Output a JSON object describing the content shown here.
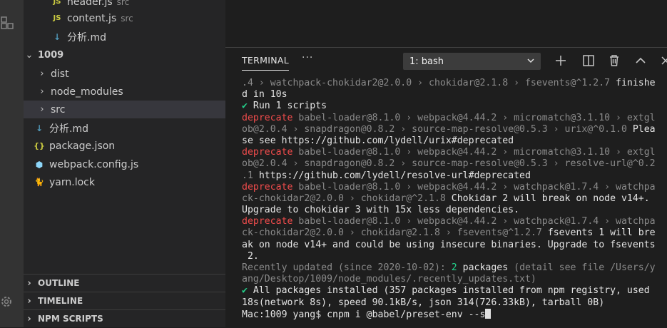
{
  "explorer": {
    "items": [
      {
        "name": "header.js",
        "desc": "src",
        "icon": "JS"
      },
      {
        "name": "content.js",
        "desc": "src",
        "icon": "JS"
      },
      {
        "name": "分析.md",
        "desc": "",
        "icon": "↓"
      }
    ],
    "folder": "1009",
    "children": [
      {
        "name": "dist"
      },
      {
        "name": "node_modules"
      },
      {
        "name": "src"
      },
      {
        "name": "分析.md",
        "icon": "↓"
      },
      {
        "name": "package.json",
        "icon": "{}"
      },
      {
        "name": "webpack.config.js",
        "icon": "⬢"
      },
      {
        "name": "yarn.lock",
        "icon": "🐈"
      }
    ]
  },
  "sections": {
    "outline": "OUTLINE",
    "timeline": "TIMELINE",
    "npm_scripts": "NPM SCRIPTS"
  },
  "panel": {
    "tab": "TERMINAL",
    "more": "···",
    "selected_terminal": "1: bash"
  },
  "terminal_lines": [
    [
      {
        "c": "dim",
        "t": ".4 › watchpack-chokidar2@2.0.0 › chokidar@2.1.8 › fsevents@^1.2.7 "
      },
      {
        "c": "wht",
        "t": "finishe"
      }
    ],
    [
      {
        "c": "wht",
        "t": "d in 10s"
      }
    ],
    [
      {
        "c": "grn",
        "t": "✔ "
      },
      {
        "c": "wht",
        "t": "Run 1 scripts"
      }
    ],
    [
      {
        "c": "red",
        "t": "deprecate "
      },
      {
        "c": "dim",
        "t": "babel-loader@8.1.0 › webpack@4.44.2 › micromatch@3.1.10 › extgl"
      }
    ],
    [
      {
        "c": "dim",
        "t": "ob@2.0.4 › snapdragon@0.8.2 › source-map-resolve@0.5.3 › urix@^0.1.0 "
      },
      {
        "c": "wht",
        "t": "Plea"
      }
    ],
    [
      {
        "c": "wht",
        "t": "se see https://github.com/lydell/urix#deprecated"
      }
    ],
    [
      {
        "c": "red",
        "t": "deprecate "
      },
      {
        "c": "dim",
        "t": "babel-loader@8.1.0 › webpack@4.44.2 › micromatch@3.1.10 › extgl"
      }
    ],
    [
      {
        "c": "dim",
        "t": "ob@2.0.4 › snapdragon@0.8.2 › source-map-resolve@0.5.3 › resolve-url@^0.2"
      }
    ],
    [
      {
        "c": "dim",
        "t": ".1 "
      },
      {
        "c": "wht",
        "t": "https://github.com/lydell/resolve-url#deprecated"
      }
    ],
    [
      {
        "c": "red",
        "t": "deprecate "
      },
      {
        "c": "dim",
        "t": "babel-loader@8.1.0 › webpack@4.44.2 › watchpack@1.7.4 › watchpa"
      }
    ],
    [
      {
        "c": "dim",
        "t": "ck-chokidar2@2.0.0 › chokidar@^2.1.8 "
      },
      {
        "c": "wht",
        "t": "Chokidar 2 will break on node v14+."
      }
    ],
    [
      {
        "c": "wht",
        "t": "Upgrade to chokidar 3 with 15x less dependencies."
      }
    ],
    [
      {
        "c": "red",
        "t": "deprecate "
      },
      {
        "c": "dim",
        "t": "babel-loader@8.1.0 › webpack@4.44.2 › watchpack@1.7.4 › watchpa"
      }
    ],
    [
      {
        "c": "dim",
        "t": "ck-chokidar2@2.0.0 › chokidar@2.1.8 › fsevents@^1.2.7 "
      },
      {
        "c": "wht",
        "t": "fsevents 1 will bre"
      }
    ],
    [
      {
        "c": "wht",
        "t": "ak on node v14+ and could be using insecure binaries. Upgrade to fsevents"
      }
    ],
    [
      {
        "c": "wht",
        "t": " 2."
      }
    ],
    [
      {
        "c": "dim",
        "t": "Recently updated (since 2020-10-02): "
      },
      {
        "c": "grn",
        "t": "2 "
      },
      {
        "c": "wht",
        "t": "packages "
      },
      {
        "c": "dim",
        "t": "(detail see file /Users/y"
      }
    ],
    [
      {
        "c": "dim",
        "t": "ang/Desktop/1009/node_modules/.recently_updates.txt)"
      }
    ],
    [
      {
        "c": "grn",
        "t": "✔ "
      },
      {
        "c": "wht",
        "t": "All packages installed (357 packages installed from npm registry, used"
      }
    ],
    [
      {
        "c": "wht",
        "t": "18s(network 8s), speed 90.1kB/s, json 314(726.33kB), tarball 0B)"
      }
    ],
    [
      {
        "c": "wht",
        "t": "Mac:1009 yang$ cnpm i @babel/preset-env --s"
      }
    ]
  ],
  "colors": {
    "red": "#f14c4c",
    "green": "#23d18b",
    "js_yellow": "#cbcb41",
    "md_blue": "#519aba"
  }
}
